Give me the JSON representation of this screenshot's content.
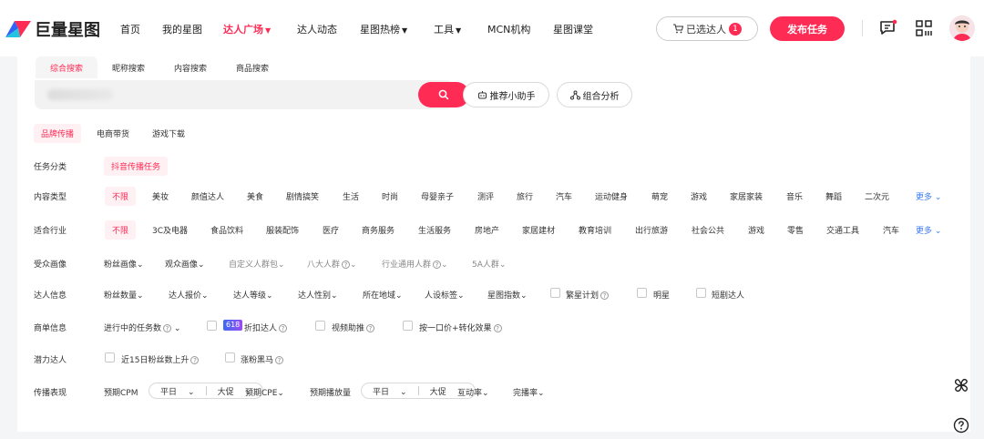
{
  "brand": {
    "name": "巨量星图",
    "accent": "#fe2c55",
    "link_color": "#3b7bf7"
  },
  "nav": {
    "home": "首页",
    "my": "我的星图",
    "plaza": "达人广场",
    "dynamics": "达人动态",
    "hot": "星图热榜",
    "tools": "工具",
    "mcn": "MCN机构",
    "class": "星图课堂"
  },
  "header": {
    "selected_label": "已选达人",
    "selected_count": "1",
    "publish_label": "发布任务",
    "icons": [
      "cart-icon",
      "message-icon",
      "grid-icon",
      "avatar"
    ]
  },
  "search": {
    "tabs": [
      "综合搜索",
      "昵称搜索",
      "内容搜索",
      "商品搜索"
    ],
    "active_tab": "综合搜索",
    "assistant": "推荐小助手",
    "combo": "组合分析"
  },
  "sub_tabs": [
    "品牌传播",
    "电商带货",
    "游戏下载"
  ],
  "filters": {
    "task_category": {
      "label": "任务分类",
      "value": "抖音传播任务"
    },
    "content_type": {
      "label": "内容类型",
      "all": "不限",
      "items": [
        "美妆",
        "颜值达人",
        "美食",
        "剧情搞笑",
        "生活",
        "时尚",
        "母婴亲子",
        "测评",
        "旅行",
        "汽车",
        "运动健身",
        "萌宠",
        "游戏",
        "家居家装",
        "音乐",
        "舞蹈",
        "二次元"
      ],
      "more": "更多"
    },
    "industry": {
      "label": "适合行业",
      "all": "不限",
      "items": [
        "3C及电器",
        "食品饮料",
        "服装配饰",
        "医疗",
        "商务服务",
        "生活服务",
        "房地产",
        "家居建材",
        "教育培训",
        "出行旅游",
        "社会公共",
        "游戏",
        "零售",
        "交通工具",
        "汽车"
      ],
      "more": "更多"
    },
    "audience": {
      "label": "受众画像",
      "items": [
        "粉丝画像",
        "观众画像",
        "自定义人群包",
        "八大人群",
        "行业通用人群",
        "5A人群"
      ]
    },
    "creator_info": {
      "label": "达人信息",
      "items": [
        "粉丝数量",
        "达人报价",
        "达人等级",
        "达人性别",
        "所在地域",
        "人设标签",
        "星图指数"
      ],
      "checks": [
        "繁星计划",
        "明星",
        "短剧达人"
      ]
    },
    "order_info": {
      "label": "商单信息",
      "ongoing": "进行中的任务数",
      "badge": "618",
      "discount": "折扣达人",
      "video_boost": "视频助推",
      "one_price": "按一口价+转化效果"
    },
    "potential": {
      "label": "潜力达人",
      "fans_up": "近15日粉丝数上升",
      "dark_horse": "涨粉黑马"
    },
    "performance": {
      "label": "传播表现",
      "cpm": "预期CPM",
      "platform": "平日",
      "promo": "大促",
      "cpe": "预期CPE",
      "plays": "预期播放量",
      "interaction": "互动率",
      "completion": "完播率"
    }
  }
}
